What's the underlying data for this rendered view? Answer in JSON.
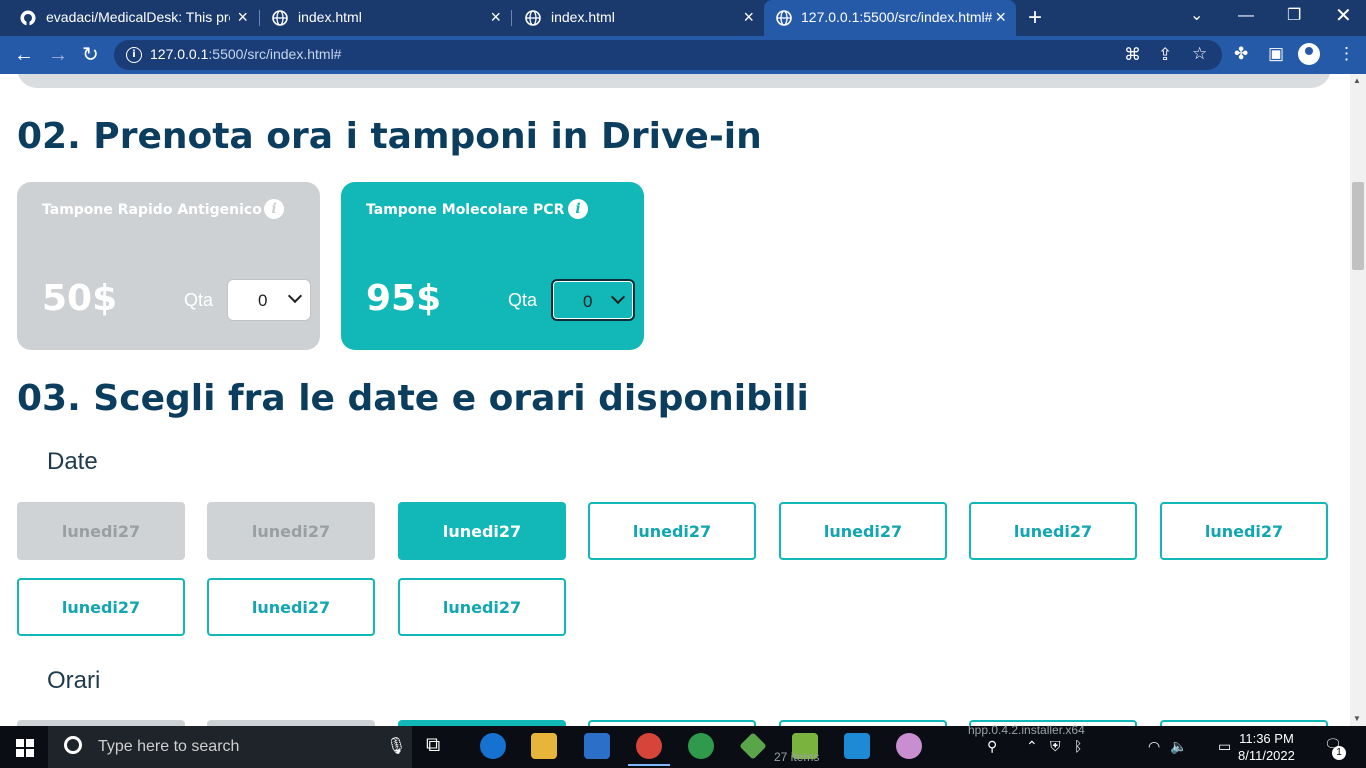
{
  "browser": {
    "tabs": [
      {
        "title": "evadaci/MedicalDesk: This projec",
        "icon": "github-icon",
        "active": false
      },
      {
        "title": "index.html",
        "icon": "globe-icon",
        "active": false
      },
      {
        "title": "index.html",
        "icon": "globe-icon",
        "active": false
      },
      {
        "title": "127.0.0.1:5500/src/index.html#",
        "icon": "globe-icon",
        "active": true
      }
    ],
    "url_host": "127.0.0.1",
    "url_rest": ":5500/src/index.html#"
  },
  "section2": {
    "title": "02. Prenota ora i tamponi in Drive-in",
    "cards": [
      {
        "name": "Tampone Rapido Antigenico",
        "price": "50$",
        "qta_label": "Qta",
        "qta_value": "0",
        "style": "grey"
      },
      {
        "name": "Tampone Molecolare PCR",
        "price": "95$",
        "qta_label": "Qta",
        "qta_value": "0",
        "style": "teal"
      }
    ]
  },
  "section3": {
    "title": "03. Scegli fra le date e orari disponibili",
    "dates_label": "Date",
    "dates": [
      {
        "label": "lunedi27",
        "state": "disabled"
      },
      {
        "label": "lunedi27",
        "state": "disabled"
      },
      {
        "label": "lunedi27",
        "state": "selected"
      },
      {
        "label": "lunedi27",
        "state": "available"
      },
      {
        "label": "lunedi27",
        "state": "available"
      },
      {
        "label": "lunedi27",
        "state": "available"
      },
      {
        "label": "lunedi27",
        "state": "available"
      },
      {
        "label": "lunedi27",
        "state": "available"
      },
      {
        "label": "lunedi27",
        "state": "available"
      },
      {
        "label": "lunedi27",
        "state": "available"
      }
    ],
    "times_label": "Orari"
  },
  "taskbar": {
    "search_placeholder": "Type here to search",
    "time": "11:36 PM",
    "date": "8/11/2022",
    "notification_count": "1",
    "ghost_text_1": "hpp.0.4.2.installer.x64",
    "ghost_text_2": "27 items"
  },
  "colors": {
    "teal": "#12b7b7",
    "navy_heading": "#0b3d5e",
    "disabled_grey": "#cfd3d5",
    "chrome_blue": "#255aa8"
  }
}
